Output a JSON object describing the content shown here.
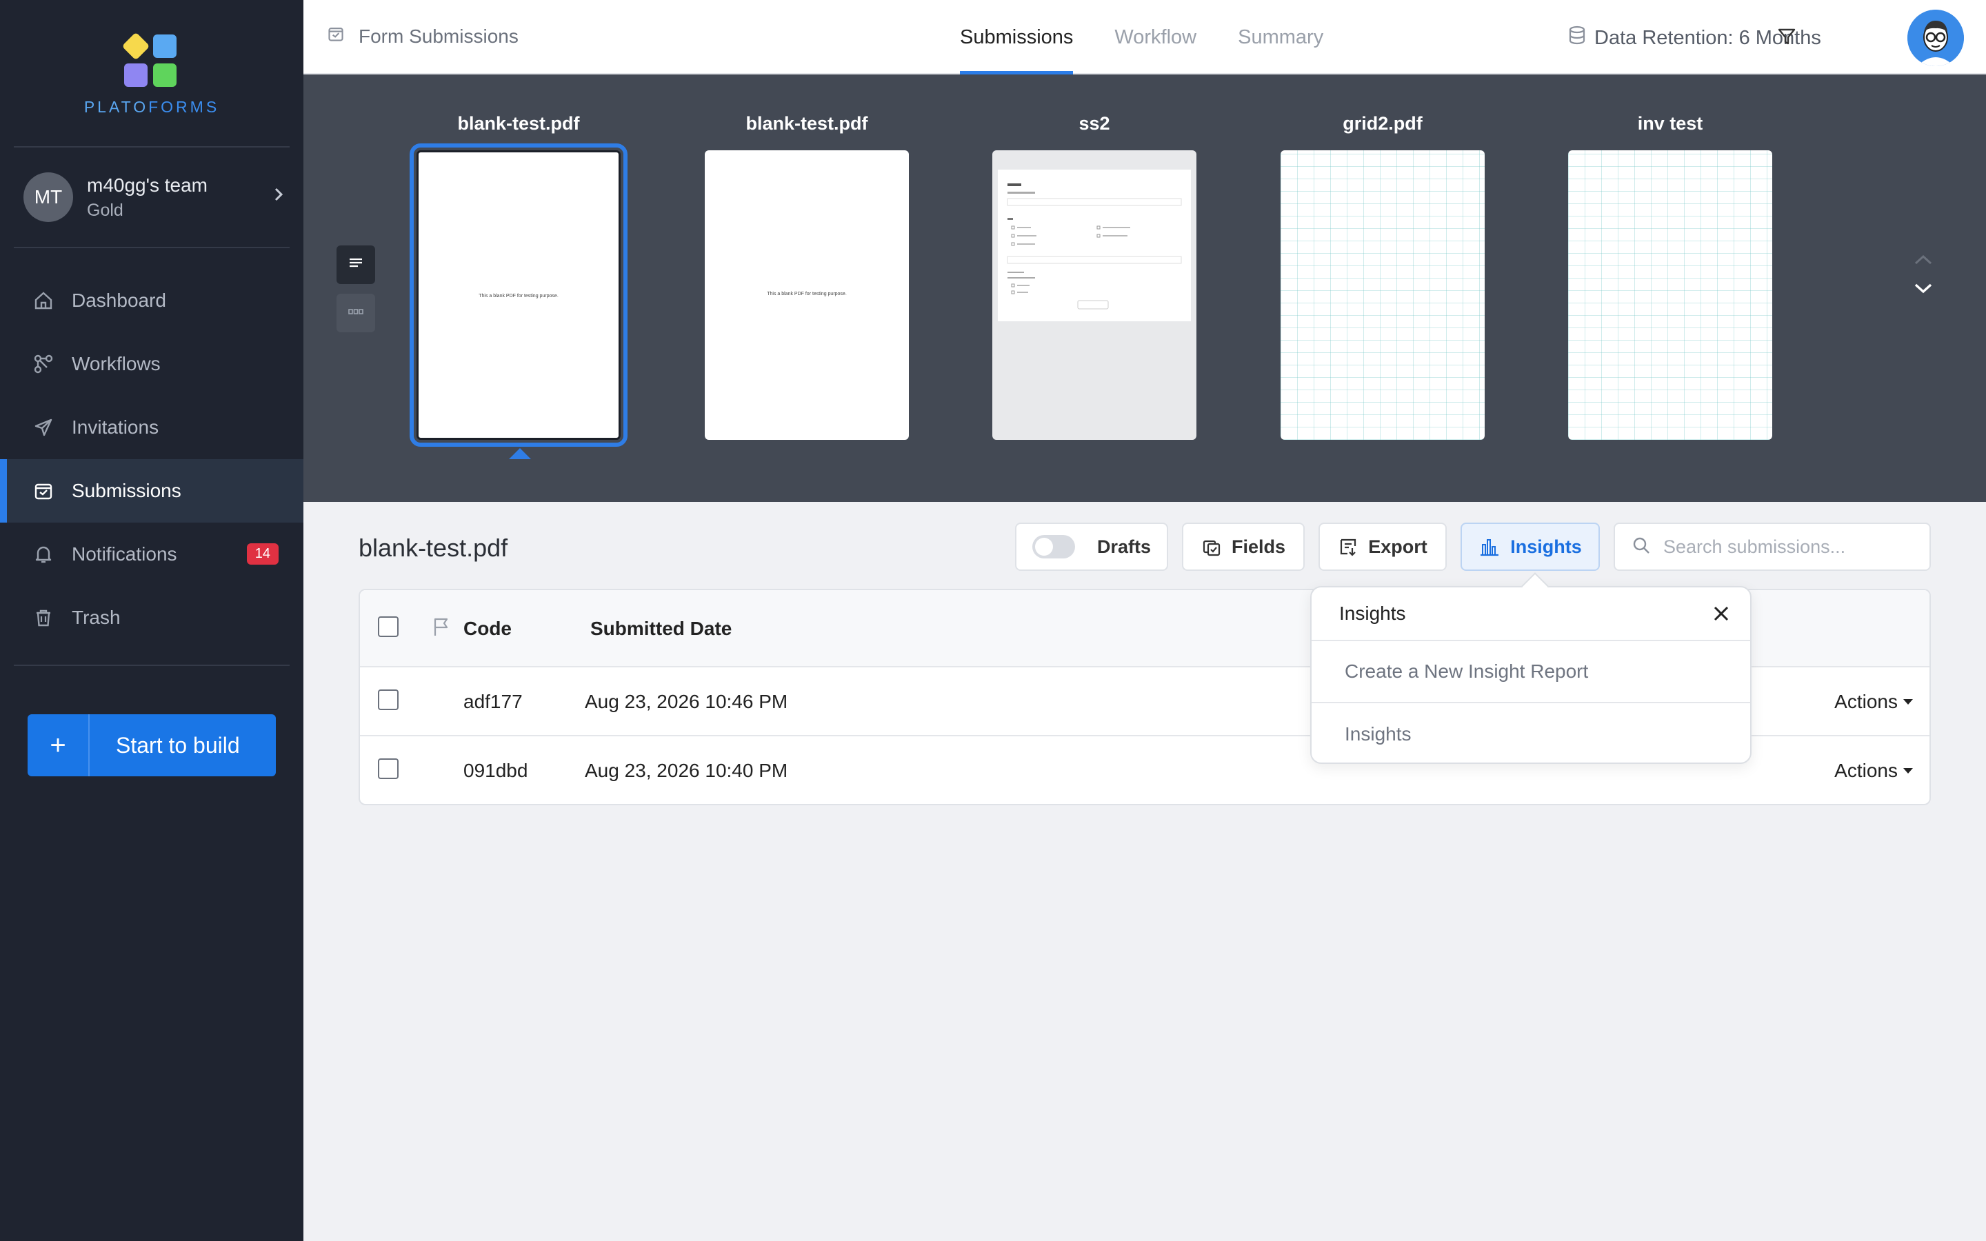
{
  "brand": {
    "name_left": "PLATO",
    "name_right": "FORMS"
  },
  "team": {
    "initials": "MT",
    "name": "m40gg's team",
    "plan": "Gold"
  },
  "sidebar": {
    "items": [
      {
        "label": "Dashboard",
        "icon": "home-icon"
      },
      {
        "label": "Workflows",
        "icon": "workflow-icon"
      },
      {
        "label": "Invitations",
        "icon": "send-icon"
      },
      {
        "label": "Submissions",
        "icon": "inbox-icon",
        "active": true
      },
      {
        "label": "Notifications",
        "icon": "bell-icon",
        "badge": "14"
      },
      {
        "label": "Trash",
        "icon": "trash-icon"
      }
    ],
    "build_button": {
      "icon": "+",
      "label": "Start to build"
    }
  },
  "header": {
    "breadcrumb": "Form Submissions",
    "tabs": [
      {
        "label": "Submissions",
        "active": true
      },
      {
        "label": "Workflow"
      },
      {
        "label": "Summary"
      }
    ],
    "retention": "Data Retention: 6 Months"
  },
  "thumbnails": [
    {
      "title": "blank-test.pdf",
      "preview_text": "This a blank PDF for testing purpose.",
      "selected": true
    },
    {
      "title": "blank-test.pdf",
      "preview_text": "This a blank PDF for testing purpose."
    },
    {
      "title": "ss2"
    },
    {
      "title": "grid2.pdf"
    },
    {
      "title": "inv test"
    }
  ],
  "content": {
    "title": "blank-test.pdf",
    "toolbar": {
      "drafts": "Drafts",
      "fields": "Fields",
      "export": "Export",
      "insights": "Insights",
      "search_placeholder": "Search submissions..."
    },
    "table": {
      "headers": {
        "code": "Code",
        "date": "Submitted Date"
      },
      "rows": [
        {
          "code": "adf177",
          "date": "Aug 23, 2026 10:46 PM",
          "actions": "Actions"
        },
        {
          "code": "091dbd",
          "date": "Aug 23, 2026 10:40 PM",
          "actions": "Actions"
        }
      ]
    }
  },
  "popover": {
    "title": "Insights",
    "items": [
      "Create a New Insight Report",
      "Insights"
    ]
  },
  "colors": {
    "accent": "#2b7de9",
    "sidebar_bg": "#1f2430",
    "strip_bg": "#434954",
    "badge": "#e03142"
  }
}
